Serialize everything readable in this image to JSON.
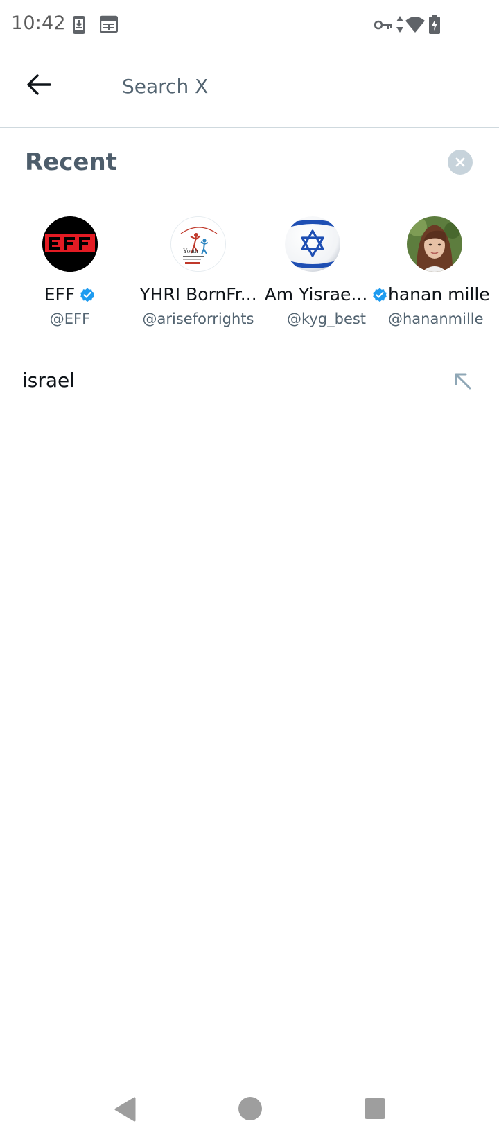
{
  "status_bar": {
    "time": "10:42",
    "left_icons": [
      "download-notification-icon",
      "calendar-notification-icon"
    ],
    "right_icons": [
      "vpn-key-icon",
      "data-activity-icon",
      "wifi-icon",
      "battery-charging-icon"
    ]
  },
  "search": {
    "placeholder": "Search X",
    "value": ""
  },
  "recent": {
    "title": "Recent",
    "accounts": [
      {
        "name": "EFF",
        "handle": "@EFF",
        "verified": true,
        "avatar": "eff-logo"
      },
      {
        "name": "YHRI BornFr...",
        "handle": "@ariseforrights",
        "verified": false,
        "avatar": "youth-for-human-rights-logo"
      },
      {
        "name": "Am Yisrae...",
        "handle": "@kyg_best",
        "verified": true,
        "avatar": "star-of-david-flag"
      },
      {
        "name": "hanan mille",
        "handle": "@hananmille",
        "verified": false,
        "avatar": "profile-photo"
      }
    ],
    "searches": [
      {
        "query": "israel"
      }
    ]
  },
  "colors": {
    "accent": "#1d9bf0",
    "secondary_text": "#536471",
    "divider": "#cfd9de",
    "eff_red": "#e31b23"
  }
}
